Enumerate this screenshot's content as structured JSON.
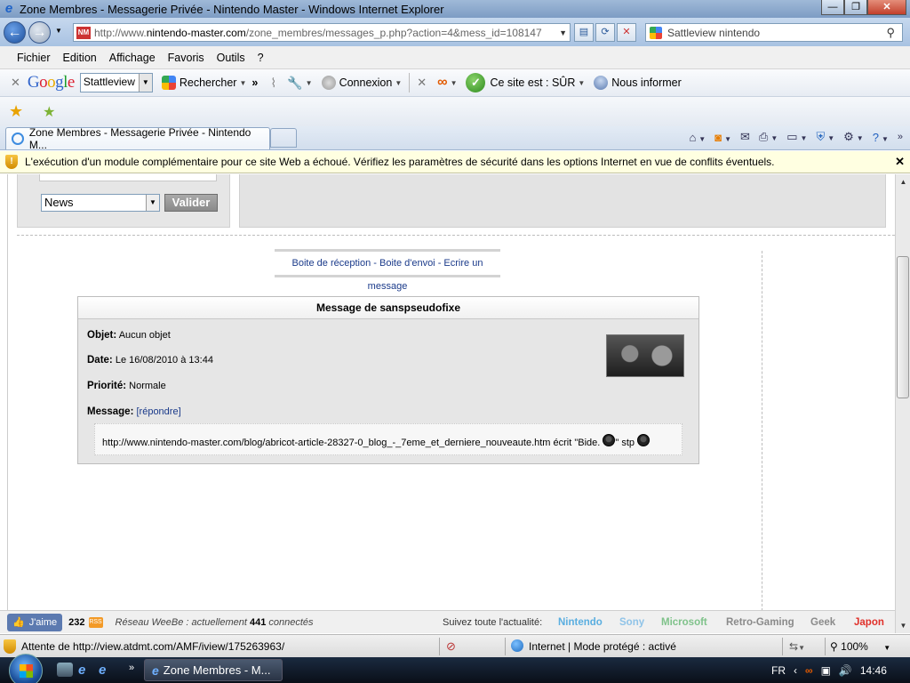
{
  "window": {
    "title": "Zone Membres - Messagerie Privée - Nintendo Master - Windows Internet Explorer",
    "controls": {
      "minimize": "—",
      "maximize": "❐",
      "close": "✕"
    }
  },
  "address_bar": {
    "favicon_text": "NM",
    "url_prefix": "http://www.",
    "url_domain": "nintendo-master.com",
    "url_path": "/zone_membres/messages_p.php?action=4&mess_id=108147",
    "search_value": "Sattleview nintendo"
  },
  "menu": {
    "items": [
      "Fichier",
      "Edition",
      "Affichage",
      "Favoris",
      "Outils",
      "?"
    ]
  },
  "google_toolbar": {
    "search_value": "Stattleview",
    "rechercher": "Rechercher",
    "connexion": "Connexion",
    "site_status": "Ce site est : SÛR",
    "nous_informer": "Nous informer"
  },
  "tabs": {
    "active_tab": "Zone Membres - Messagerie Privée - Nintendo M..."
  },
  "info_bar": {
    "text": "L'exécution d'un module complémentaire pour ce site Web a échoué. Vérifiez les paramètres de sécurité dans les options Internet en vue de conflits éventuels."
  },
  "page": {
    "category_select": "News",
    "valider": "Valider",
    "nav": {
      "inbox": "Boite de réception",
      "sent": "Boite d'envoi",
      "write": "Ecrire un message",
      "sep": " - "
    },
    "message": {
      "header": "Message de sanspseudofixe",
      "objet_label": "Objet:",
      "objet_value": "Aucun objet",
      "date_label": "Date:",
      "date_value": "Le 16/08/2010 à 13:44",
      "priorite_label": "Priorité:",
      "priorite_value": "Normale",
      "message_label": "Message:",
      "repondre": "[répondre]",
      "body_text": "http://www.nintendo-master.com/blog/abricot-article-28327-0_blog_-_7eme_et_derniere_nouveaute.htm écrit \"Bide.",
      "body_mid": "\" stp"
    },
    "bottom": {
      "jaime": "J'aime",
      "count": "232",
      "rss": "RSS",
      "reseau_prefix": "Réseau WeeBe : actuellement",
      "reseau_count": "441",
      "reseau_suffix": "connectés",
      "suivez": "Suivez toute l'actualité:",
      "categories": [
        {
          "label": "Nintendo",
          "color": "#5aaee0"
        },
        {
          "label": "Sony",
          "color": "#8fc3e8"
        },
        {
          "label": "Microsoft",
          "color": "#7fc28a"
        },
        {
          "label": "Retro-Gaming",
          "color": "#8a8a8a"
        },
        {
          "label": "Geek",
          "color": "#8a8a8a"
        },
        {
          "label": "Japon",
          "color": "#e0302a"
        }
      ]
    }
  },
  "status_bar": {
    "text": "Attente de http://view.atdmt.com/AMF/iview/175263963/",
    "zone": "Internet | Mode protégé : activé",
    "zoom": "100%"
  },
  "taskbar": {
    "task_label": "Zone Membres - M...",
    "lang": "FR",
    "time": "14:46"
  }
}
